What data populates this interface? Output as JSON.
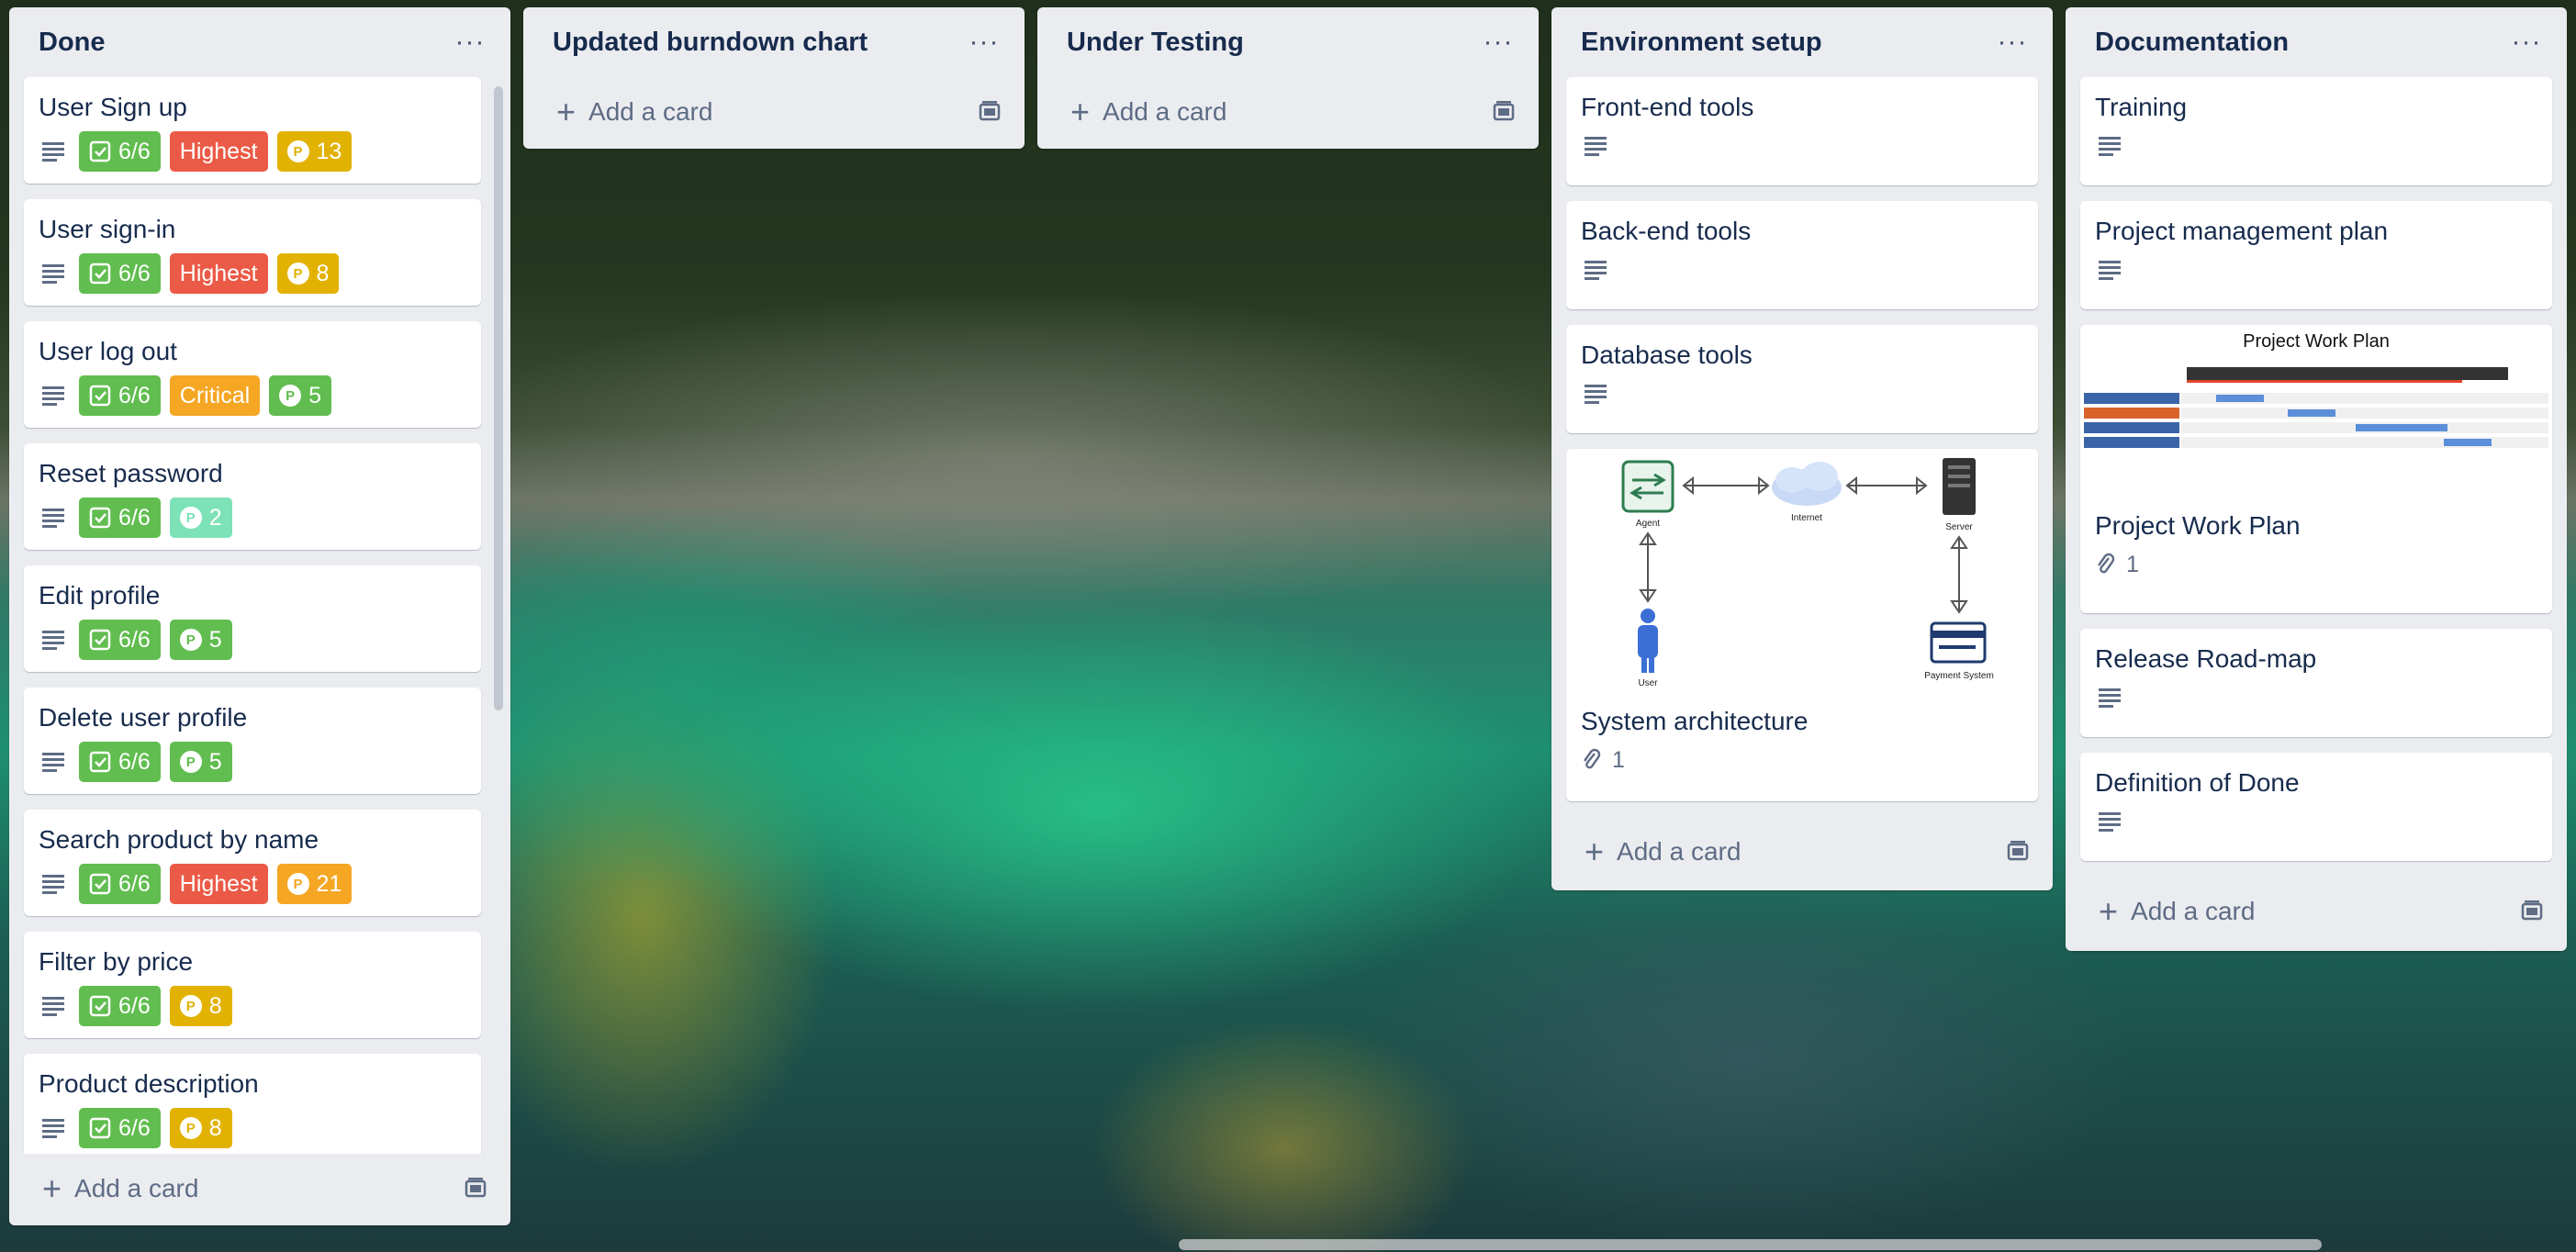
{
  "lists": [
    {
      "title": "Done",
      "add_card": "Add a card",
      "cards": [
        {
          "title": "User Sign up",
          "checklist": "6/6",
          "priority": "Highest",
          "points": "13",
          "points_color": "#e2b203"
        },
        {
          "title": "User sign-in",
          "checklist": "6/6",
          "priority": "Highest",
          "points": "8",
          "points_color": "#e2b203"
        },
        {
          "title": "User log out",
          "checklist": "6/6",
          "priority": "Critical",
          "points": "5",
          "points_color": "#61bd4f"
        },
        {
          "title": "Reset password",
          "checklist": "6/6",
          "points": "2",
          "points_color": "#7ee2b8"
        },
        {
          "title": "Edit profile",
          "checklist": "6/6",
          "points": "5",
          "points_color": "#61bd4f"
        },
        {
          "title": "Delete user profile",
          "checklist": "6/6",
          "points": "5",
          "points_color": "#61bd4f"
        },
        {
          "title": "Search product by name",
          "checklist": "6/6",
          "priority": "Highest",
          "points": "21",
          "points_color": "#f5a623"
        },
        {
          "title": "Filter by price",
          "checklist": "6/6",
          "points": "8",
          "points_color": "#e2b203"
        },
        {
          "title": "Product description",
          "checklist": "6/6",
          "points": "8",
          "points_color": "#e2b203"
        }
      ]
    },
    {
      "title": "Updated burndown chart",
      "add_card": "Add a card"
    },
    {
      "title": "Under Testing",
      "add_card": "Add a card"
    },
    {
      "title": "Environment setup",
      "add_card": "Add a card",
      "cards": [
        {
          "title": "Front-end tools"
        },
        {
          "title": "Back-end tools"
        },
        {
          "title": "Database tools"
        },
        {
          "title": "System architecture",
          "attachments": "1",
          "diagram": {
            "agent": "Agent",
            "internet": "Internet",
            "server": "Server",
            "user": "User",
            "payment": "Payment System"
          }
        }
      ]
    },
    {
      "title": "Documentation",
      "add_card": "Add a card",
      "cards": [
        {
          "title": "Training"
        },
        {
          "title": "Project management plan"
        },
        {
          "title": "Project Work Plan",
          "attachments": "1",
          "cover_title": "Project Work Plan"
        },
        {
          "title": "Release Road-map"
        },
        {
          "title": "Definition of Done"
        }
      ]
    }
  ],
  "colors": {
    "checklist": "#61bd4f",
    "highest": "#eb5a46",
    "critical": "#f5a623",
    "list_bg": "#ebecf0"
  }
}
